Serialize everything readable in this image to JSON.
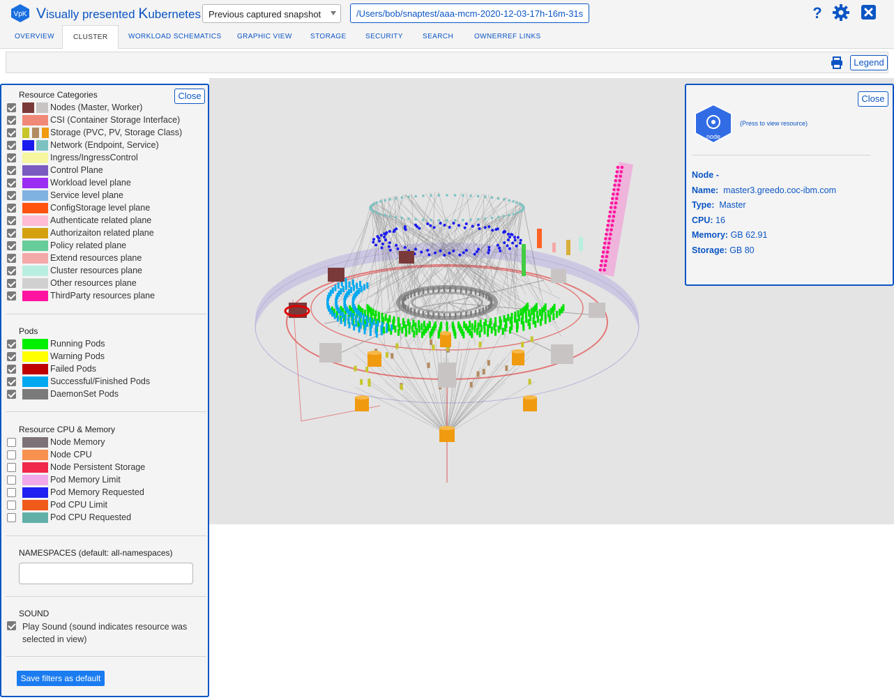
{
  "app": {
    "logo_text": "VpK",
    "brand_first": "V",
    "brand_mid": "isually presented ",
    "brand_k": "K",
    "brand_last": "ubernetes"
  },
  "snapshot": {
    "selected": "Previous captured snapshot",
    "path": "/Users/bob/snaptest/aaa-mcm-2020-12-03-17h-16m-31s"
  },
  "top_icons": [
    "help-icon",
    "gear-icon",
    "close-window-icon"
  ],
  "tabs": [
    {
      "label": "OVERVIEW",
      "active": false
    },
    {
      "label": "CLUSTER",
      "active": true
    },
    {
      "label": "WORKLOAD SCHEMATICS",
      "active": false
    },
    {
      "label": "GRAPHIC VIEW",
      "active": false
    },
    {
      "label": "STORAGE",
      "active": false
    },
    {
      "label": "SECURITY",
      "active": false
    },
    {
      "label": "SEARCH",
      "active": false
    },
    {
      "label": "OWNERREF LINKS",
      "active": false
    }
  ],
  "toolbar": {
    "legend_label": "Legend"
  },
  "left_panel": {
    "close_label": "Close",
    "resource_categories_title": "Resource Categories",
    "categories": [
      {
        "label": "Nodes (Master, Worker)",
        "checked": true,
        "colors": [
          "#7b3a3a",
          "#c8c4c4"
        ]
      },
      {
        "label": "CSI (Container Storage Interface)",
        "checked": true,
        "colors": [
          "#f08878"
        ]
      },
      {
        "label": "Storage (PVC, PV, Storage Class)",
        "checked": true,
        "colors": [
          "#c6c62a",
          "#b38b62",
          "#f09a10"
        ]
      },
      {
        "label": "Network (Endpoint, Service)",
        "checked": true,
        "colors": [
          "#1a1aee",
          "#7cc2c2"
        ]
      },
      {
        "label": "Ingress/IngressControl",
        "checked": true,
        "colors": [
          "#f6f6a0"
        ]
      },
      {
        "label": "Control Plane",
        "checked": true,
        "colors": [
          "#7a5cc0"
        ]
      },
      {
        "label": "Workload level plane",
        "checked": true,
        "colors": [
          "#9a2ef2"
        ]
      },
      {
        "label": "Service level plane",
        "checked": true,
        "colors": [
          "#7fb2e0"
        ]
      },
      {
        "label": "ConfigStorage level plane",
        "checked": true,
        "colors": [
          "#ff5410"
        ]
      },
      {
        "label": "Authenticate related plane",
        "checked": true,
        "colors": [
          "#ffbcd4"
        ]
      },
      {
        "label": "Authorizaiton related plane",
        "checked": true,
        "colors": [
          "#d4a010"
        ]
      },
      {
        "label": "Policy related plane",
        "checked": true,
        "colors": [
          "#66cc99"
        ]
      },
      {
        "label": "Extend resources plane",
        "checked": true,
        "colors": [
          "#f5a8a8"
        ]
      },
      {
        "label": "Cluster resources plane",
        "checked": true,
        "colors": [
          "#b8eee0"
        ]
      },
      {
        "label": "Other resources plane",
        "checked": true,
        "colors": [
          "#d0d0d0"
        ]
      },
      {
        "label": "ThirdParty resources plane",
        "checked": true,
        "colors": [
          "#ff14a0"
        ]
      }
    ],
    "pods_title": "Pods",
    "pods": [
      {
        "label": "Running Pods",
        "checked": true,
        "color": "#00f000"
      },
      {
        "label": "Warning Pods",
        "checked": true,
        "color": "#ffff00"
      },
      {
        "label": "Failed Pods",
        "checked": true,
        "color": "#c00000"
      },
      {
        "label": "Successful/Finished Pods",
        "checked": true,
        "color": "#00a8f0"
      },
      {
        "label": "DaemonSet Pods",
        "checked": true,
        "color": "#7a7a7a"
      }
    ],
    "cpu_mem_title": "Resource CPU & Memory",
    "cpu_mem": [
      {
        "label": "Node Memory",
        "checked": false,
        "color": "#7d7278"
      },
      {
        "label": "Node CPU",
        "checked": false,
        "color": "#f89050"
      },
      {
        "label": "Node Persistent Storage",
        "checked": false,
        "color": "#f0284a"
      },
      {
        "label": "Pod Memory Limit",
        "checked": false,
        "color": "#f0a8e8"
      },
      {
        "label": "Pod Memory Requested",
        "checked": false,
        "color": "#2020f0"
      },
      {
        "label": "Pod CPU Limit",
        "checked": false,
        "color": "#f05a1a"
      },
      {
        "label": "Pod CPU Requested",
        "checked": false,
        "color": "#60b0a8"
      }
    ],
    "namespaces_title": "NAMESPACES   (default: all-namespaces)",
    "namespaces_value": "",
    "sound_title": "SOUND",
    "sound_label": "Play Sound (sound indicates resource was selected in view)",
    "sound_checked": true,
    "save_label": "Save filters as default"
  },
  "right_panel": {
    "close_label": "Close",
    "node_icon_text": "node",
    "view_link": "(Press to view resource)",
    "heading": "Node -",
    "name_label": "Name:",
    "name_value": "master3.greedo.coc-ibm.com",
    "type_label": "Type:",
    "type_value": "Master",
    "cpu_label": "CPU:",
    "cpu_value": "16",
    "memory_label": "Memory:",
    "memory_value": "GB 62.91",
    "storage_label": "Storage:",
    "storage_value": "GB 80"
  }
}
